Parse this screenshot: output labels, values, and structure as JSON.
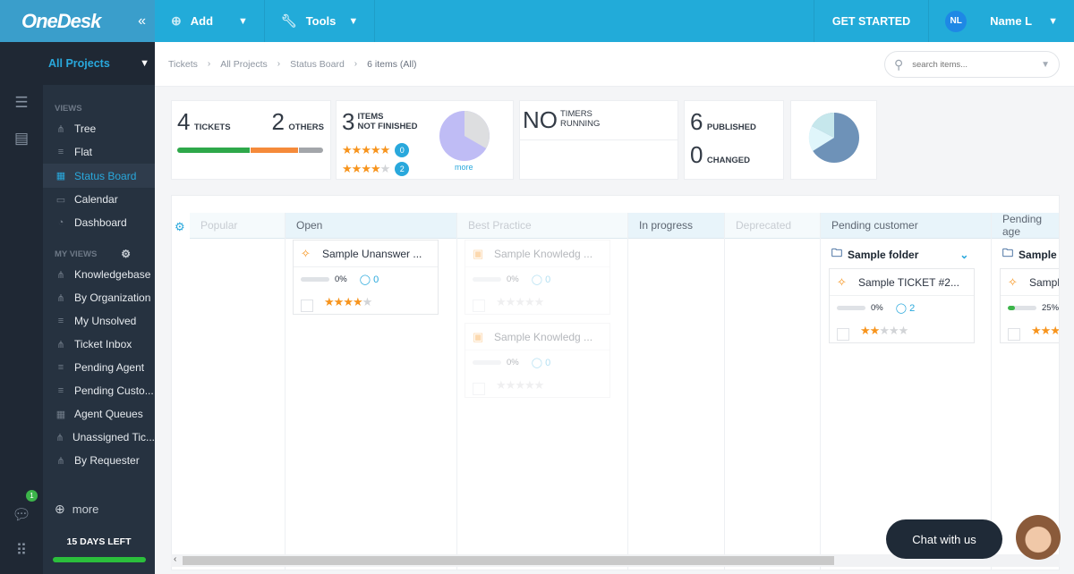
{
  "topbar": {
    "logo": "OneDesk",
    "collapse_icon": "«",
    "add_label": "Add",
    "tools_label": "Tools",
    "get_started": "GET STARTED",
    "user_initials": "NL",
    "user_name": "Name L"
  },
  "sidebar": {
    "project": "All Projects",
    "views_header": "VIEWS",
    "views": [
      {
        "label": "Tree",
        "icon": "tree-icon"
      },
      {
        "label": "Flat",
        "icon": "list-icon"
      },
      {
        "label": "Status Board",
        "icon": "grid-icon",
        "active": true
      },
      {
        "label": "Calendar",
        "icon": "calendar-icon"
      },
      {
        "label": "Dashboard",
        "icon": "pie-chart-icon"
      }
    ],
    "my_views_header": "MY VIEWS",
    "my_views": [
      {
        "label": "Knowledgebase",
        "icon": "tree-icon"
      },
      {
        "label": "By Organization",
        "icon": "tree-icon"
      },
      {
        "label": "My Unsolved",
        "icon": "list-icon"
      },
      {
        "label": "Ticket Inbox",
        "icon": "tree-icon"
      },
      {
        "label": "Pending Agent",
        "icon": "list-icon"
      },
      {
        "label": "Pending Custo...",
        "icon": "list-icon"
      },
      {
        "label": "Agent Queues",
        "icon": "grid-icon"
      },
      {
        "label": "Unassigned Tic...",
        "icon": "tree-icon"
      },
      {
        "label": "By Requester",
        "icon": "tree-icon"
      }
    ],
    "more_label": "more",
    "trial_label": "15 DAYS LEFT",
    "chat_badge": "1"
  },
  "breadcrumb": [
    "Tickets",
    "All Projects",
    "Status Board",
    "6 items (All)"
  ],
  "search": {
    "placeholder": "search items..."
  },
  "stats": {
    "tickets_count": "4",
    "tickets_label": "TICKETS",
    "others_count": "2",
    "others_label": "OTHERS",
    "status_bar": {
      "green": 0.5,
      "orange": 0.33,
      "gray": 0.17
    },
    "not_finished_count": "3",
    "not_finished_label1": "ITEMS",
    "not_finished_label2": "NOT FINISHED",
    "rating_rows": [
      {
        "stars": 5,
        "count": "0"
      },
      {
        "stars": 4,
        "count": "2"
      }
    ],
    "more_link": "more",
    "timers_count": "NO",
    "timers_label1": "TIMERS",
    "timers_label2": "RUNNING",
    "published_count": "6",
    "published_label": "PUBLISHED",
    "changed_count": "0",
    "changed_label": "CHANGED"
  },
  "board": {
    "columns": [
      {
        "name": "Popular",
        "faded": true
      },
      {
        "name": "Open",
        "faded": false
      },
      {
        "name": "Best Practice",
        "faded": true
      },
      {
        "name": "In progress",
        "faded": false
      },
      {
        "name": "Deprecated",
        "faded": true
      },
      {
        "name": "Pending customer",
        "faded": false
      },
      {
        "name": "Pending age",
        "faded": false
      }
    ],
    "cards": {
      "open": {
        "title": "Sample Unanswer ...",
        "progress": "0%",
        "comments": "0",
        "stars": 4
      },
      "bp1": {
        "title": "Sample Knowledg ...",
        "progress": "0%",
        "comments": "0",
        "stars": 0
      },
      "bp2": {
        "title": "Sample Knowledg ...",
        "progress": "0%",
        "comments": "0",
        "stars": 0
      },
      "pc": {
        "folder": "Sample folder",
        "title": "Sample TICKET #2...",
        "progress": "0%",
        "comments": "2",
        "stars": 2
      },
      "pa": {
        "folder": "Sample fo",
        "title": "Sample",
        "progress": "25%",
        "stars": 3
      }
    }
  },
  "chat": {
    "label": "Chat with us"
  }
}
